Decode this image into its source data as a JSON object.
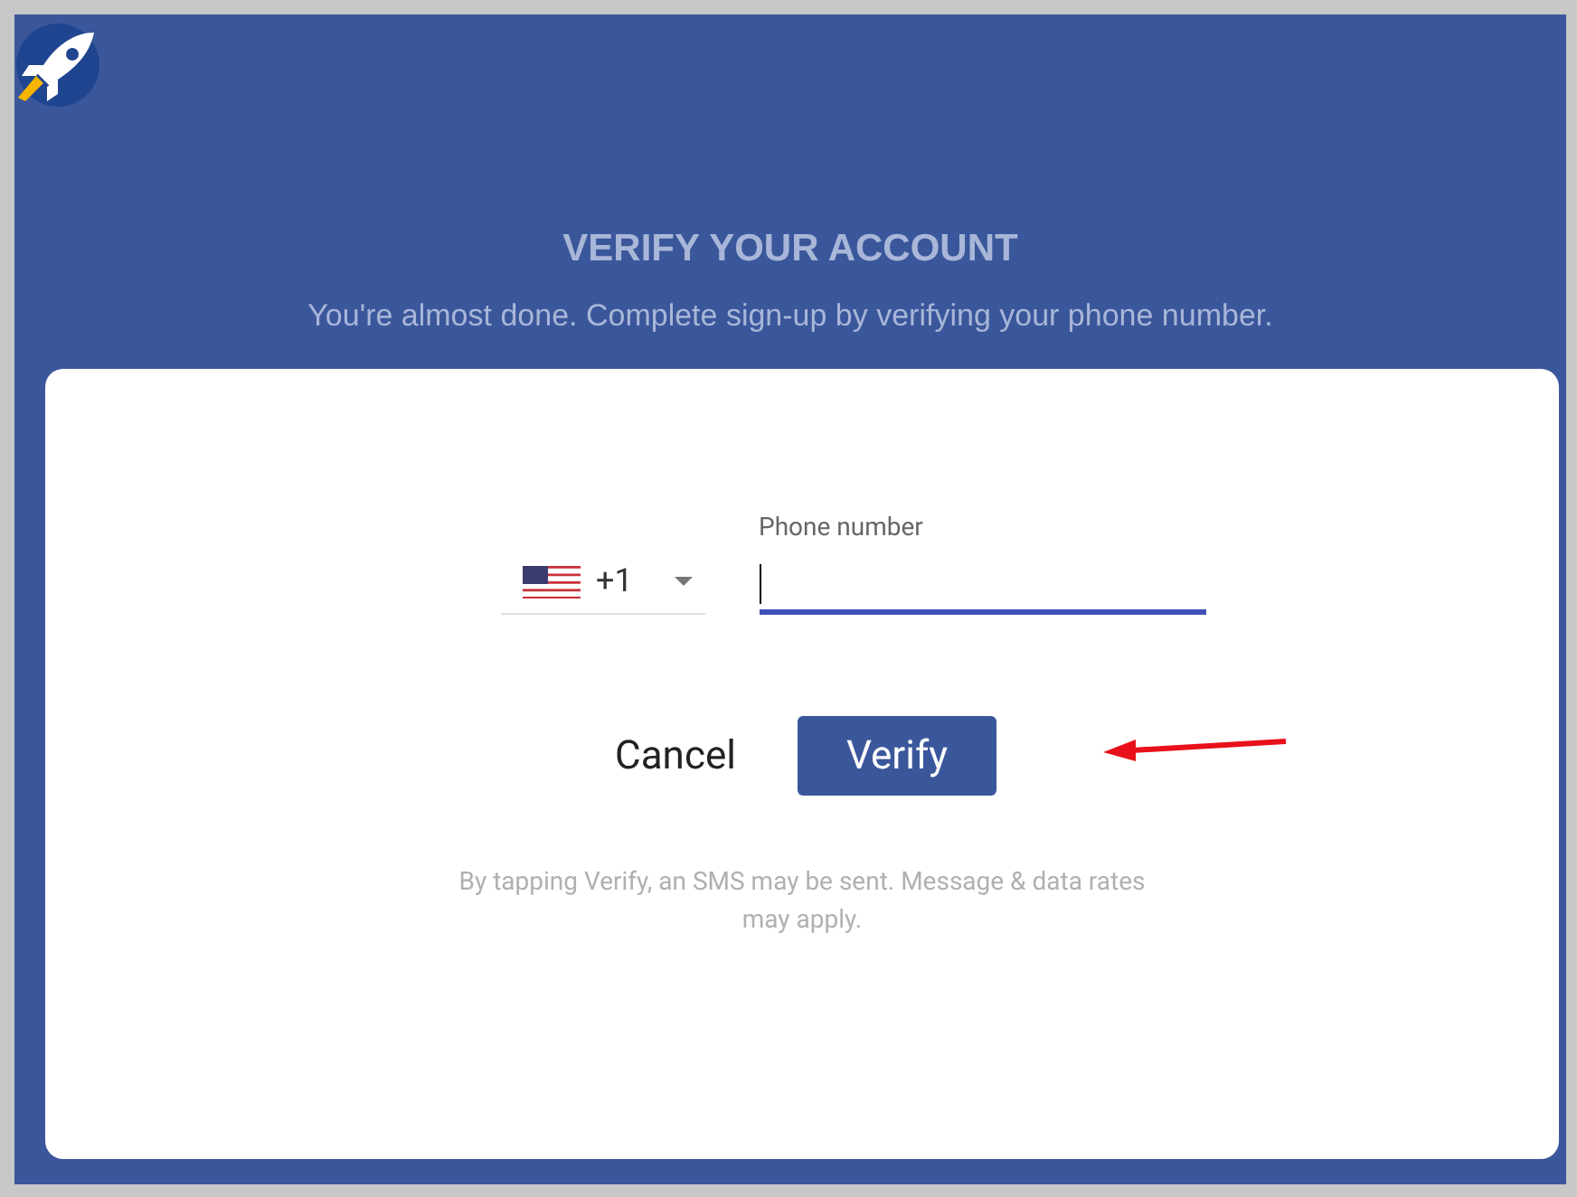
{
  "header": {
    "title": "VERIFY YOUR ACCOUNT",
    "subtitle": "You're almost done. Complete sign-up by verifying your phone number."
  },
  "country_select": {
    "code": "+1"
  },
  "phone_field": {
    "label": "Phone number",
    "focused": true
  },
  "buttons": [
    {
      "label": "Cancel",
      "kind": "text"
    },
    {
      "label": "Verify",
      "kind": "primary"
    }
  ],
  "disclaimer": "By tapping Verify, an SMS may be sent. Message & data rates may apply."
}
